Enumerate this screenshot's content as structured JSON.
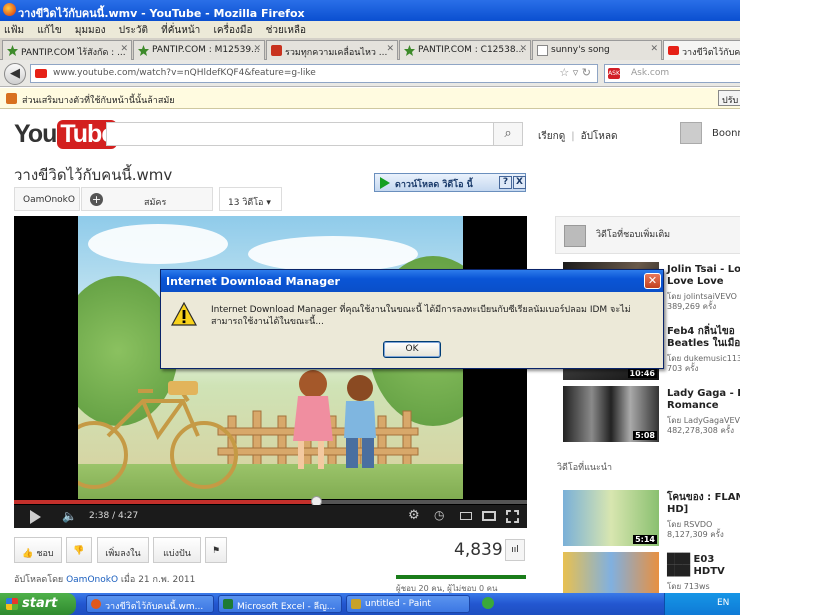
{
  "window": {
    "title": "วางขีวิดไว้กับคนนี้.wmv - YouTube - Mozilla Firefox"
  },
  "menu": [
    "แฟ้ม",
    "แก้ไข",
    "มุมมอง",
    "ประวัติ",
    "ที่คั่นหน้า",
    "เครื่องมือ",
    "ช่วยเหลือ"
  ],
  "tabs": [
    {
      "label": "PANTIP.COM ไร้สังกัด : ...",
      "icon": "pantip-icon"
    },
    {
      "label": "PANTIP.COM : M12539...",
      "icon": "pantip-icon"
    },
    {
      "label": "รวมทุกความเคลื่อนไหว ...",
      "icon": "news-icon"
    },
    {
      "label": "PANTIP.COM : C12538...",
      "icon": "pantip-icon"
    },
    {
      "label": "sunny's song",
      "icon": "page-icon"
    },
    {
      "label": "วางขีวิตไว้กับคน",
      "icon": "youtube-icon"
    }
  ],
  "nav": {
    "url": "www.youtube.com/watch?v=nQHldefKQF4&feature=g-like",
    "search_placeholder": "Ask.com",
    "search_badge": "ASK"
  },
  "notification": {
    "text": "ส่วนเสริมบางตัวที่ใช้กับหน้านี้นั้นล้าสมัย",
    "button": "ปรับ"
  },
  "youtube": {
    "logo_you": "You",
    "logo_tube": "Tube",
    "browse": "เรียกดู",
    "upload": "อัปโหลด",
    "username": "Boonn",
    "video_title": "วางขีวิดไว้กับคนนี้.wmv",
    "channel": "OamOnokO",
    "subscribe": "สมัคร",
    "video_count": "13 วิดีโอ",
    "idm_download": "ดาวน์โหลด วิดีโอ นี้",
    "idm_help": "?",
    "idm_close": "X",
    "player": {
      "time": "2:38 / 4:27",
      "progress": 0.59
    },
    "actions": {
      "like": "ชอบ",
      "add_to": "เพิ่มลงใน",
      "share": "แบ่งปัน"
    },
    "views": "4,839",
    "uploaded_prefix": "อัปโหลดโดย",
    "uploaded_channel": "OamOnokO",
    "uploaded_date": "เมื่อ 21 ก.พ. 2011",
    "likes_text": "ผู้ชอบ 20 คน, ผู้ไม่ชอบ 0 คน",
    "likes_ratio": 1.0
  },
  "sidebar": {
    "header": "วิดีโอที่ชอบเพิ่มเติม",
    "suggest_label": "วิดีโอที่แนะนำ",
    "items": [
      {
        "title1": "Jolin Tsai - Lov",
        "title2": "Love Love",
        "by": "โดย jolintsaiVEVO",
        "views": "389,269 ครั้ง",
        "duration": ""
      },
      {
        "title1": "Feb4 กลิ่นไขอ",
        "title2": "Beatles ในเมือง",
        "by": "โดย dukemusic113",
        "views": "703 ครั้ง",
        "duration": "10:46"
      },
      {
        "title1": "Lady Gaga - Ba",
        "title2": "Romance",
        "by": "โดย LadyGagaVEV",
        "views": "482,278,308 ครั้ง",
        "duration": "5:08"
      },
      {
        "title1": "โคนของ : FLAMI",
        "title2": "HD]",
        "by": "โดย RSVDO",
        "views": "8,127,309 ครั้ง",
        "duration": "5:14"
      },
      {
        "title1": "███ E03",
        "title2": "███ HDTV",
        "by": "โดย 713ws",
        "views": "",
        "duration": ""
      }
    ]
  },
  "dialog": {
    "title": "Internet Download Manager",
    "close": "✕",
    "message": "Internet Download Manager ที่คุณใช้งานในขณะนี้ ได้มีการลงทะเบียนกับซีเรียลนัมเบอร์ปลอม IDM จะไม่สามารถใช้งานได้ในขณะนี้...",
    "ok": "OK"
  },
  "taskbar": {
    "start": "start",
    "tasks": [
      {
        "label": "วางขีวิตไว้กับคนนี้.wm...",
        "color": "#e2581a"
      },
      {
        "label": "Microsoft Excel - ลีญ...",
        "color": "#1e7b34"
      },
      {
        "label": "untitled - Paint",
        "color": "#c9a227"
      }
    ],
    "lang": "EN"
  },
  "colors": {
    "youtube_red": "#d3201f",
    "xp_blue": "#2356d0",
    "start_green": "#3a9a37"
  }
}
